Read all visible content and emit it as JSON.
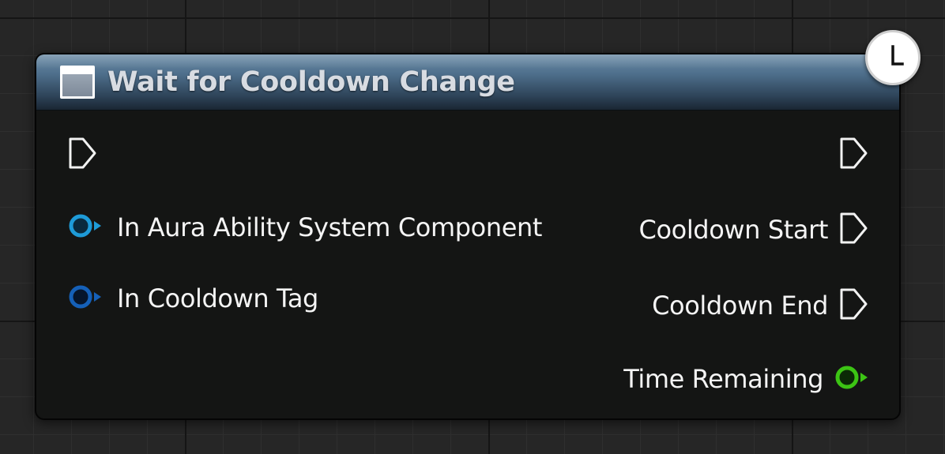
{
  "node": {
    "title": "Wait for Cooldown Change",
    "header_color": "#4e6f8c",
    "header_icon": "function-node-icon",
    "latent_icon": "clock-icon"
  },
  "inputs": {
    "exec_icon": "exec-pin-icon",
    "pins": [
      {
        "label": "In Aura Ability System Component",
        "type": "object",
        "color": "#1e9bd8",
        "icon": "object-pin-icon"
      },
      {
        "label": "In Cooldown Tag",
        "type": "struct",
        "color": "#1560b8",
        "icon": "struct-pin-icon"
      }
    ]
  },
  "outputs": {
    "exec_icon": "exec-pin-icon",
    "pins": [
      {
        "label": "Cooldown Start",
        "type": "exec",
        "color": "#ffffff",
        "icon": "exec-pin-icon"
      },
      {
        "label": "Cooldown End",
        "type": "exec",
        "color": "#ffffff",
        "icon": "exec-pin-icon"
      },
      {
        "label": "Time Remaining",
        "type": "float",
        "color": "#3cc414",
        "icon": "float-pin-icon"
      }
    ]
  }
}
